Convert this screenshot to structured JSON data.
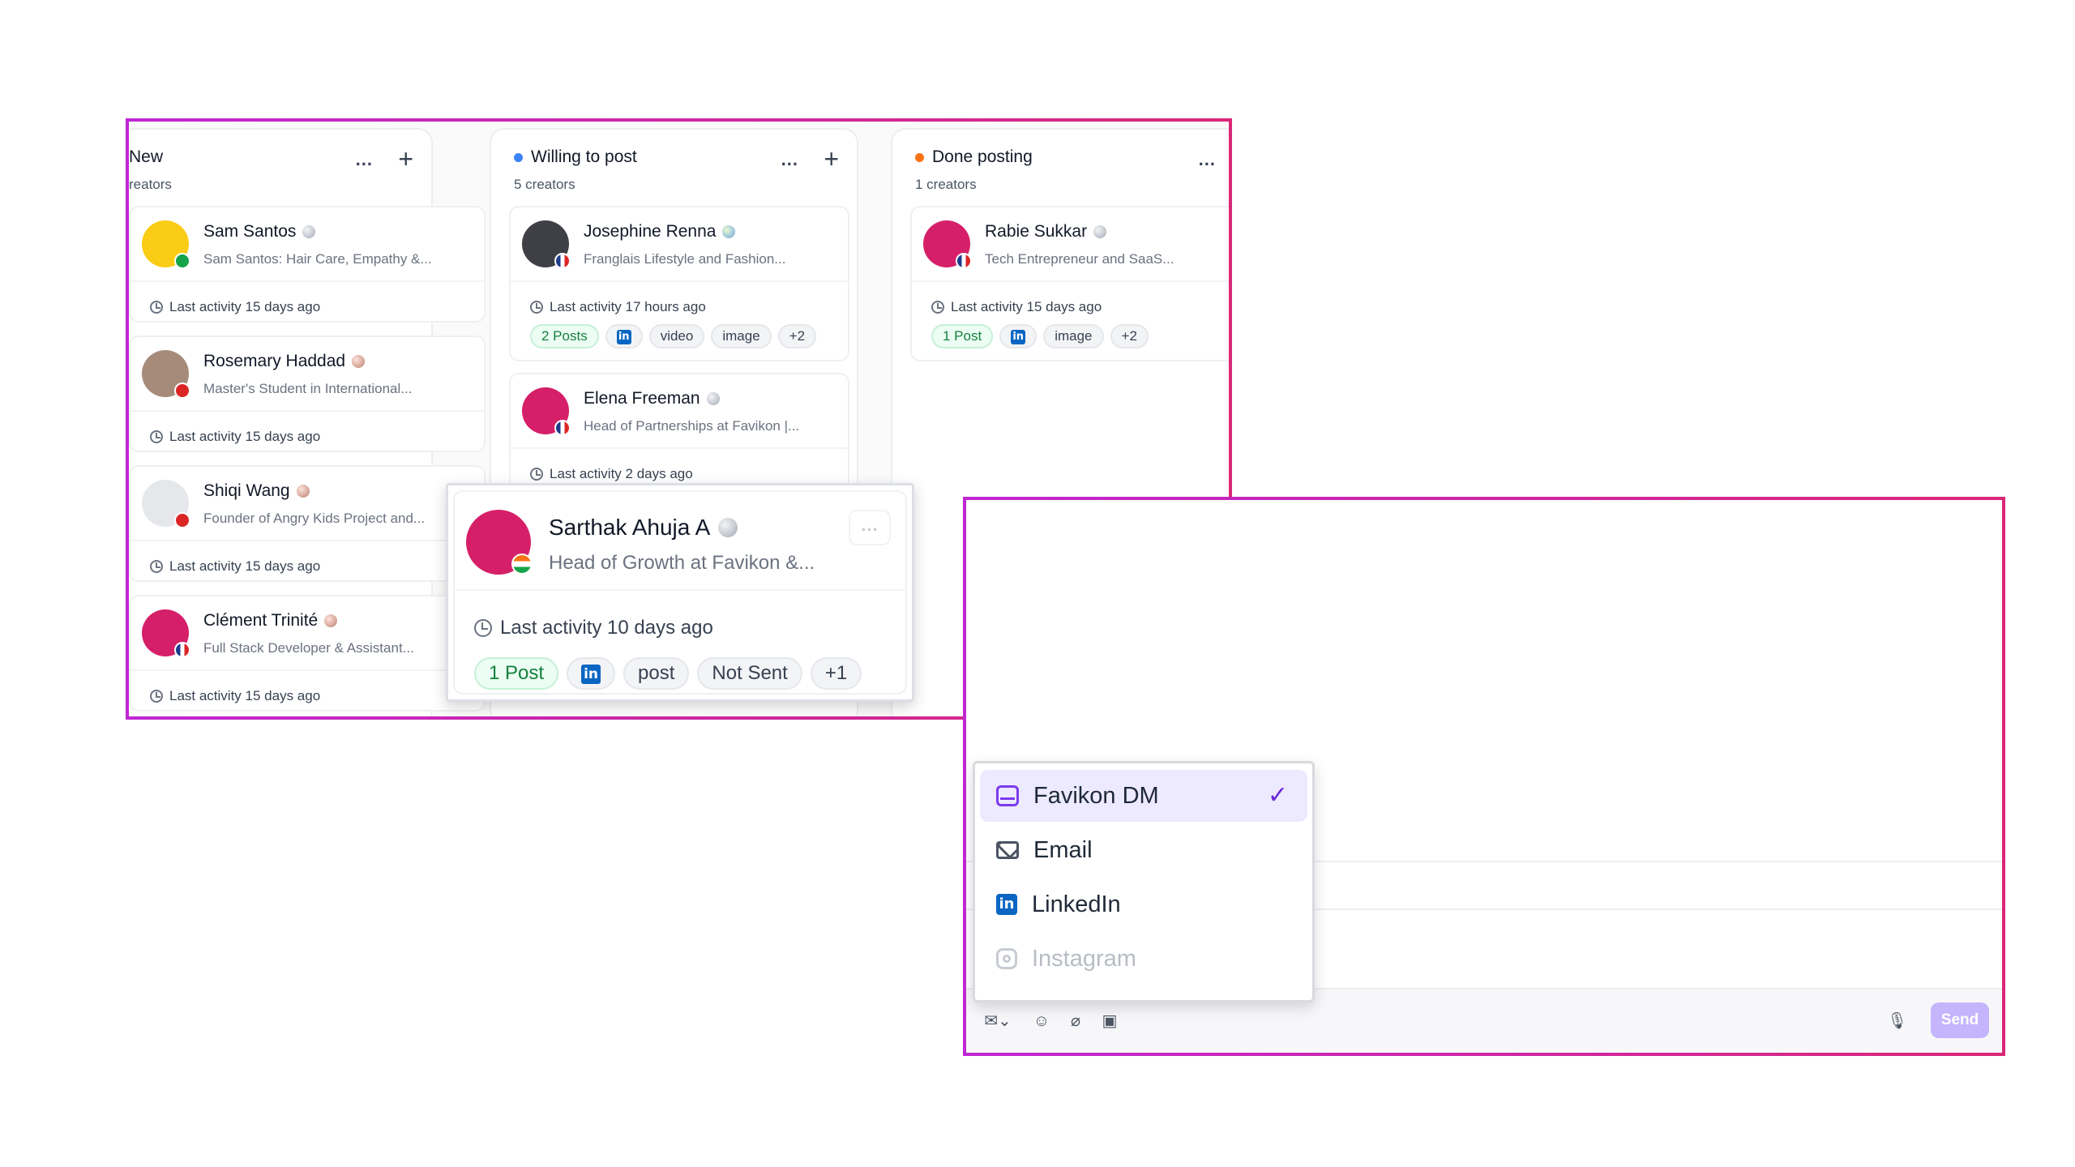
{
  "kanban": {
    "columns": [
      {
        "title": "New",
        "count": "reators",
        "more": "...",
        "add": "+",
        "cards": [
          {
            "name": "Sam Santos",
            "sub": "Sam Santos: Hair Care, Empathy &...",
            "activity": "Last activity 15 days ago"
          },
          {
            "name": "Rosemary Haddad",
            "sub": "Master's Student in International...",
            "activity": "Last activity 15 days ago"
          },
          {
            "name": "Shiqi Wang",
            "sub": "Founder of Angry Kids Project and...",
            "activity": "Last activity 15 days ago"
          },
          {
            "name": "Clément Trinité",
            "sub": "Full Stack Developer & Assistant...",
            "activity": "Last activity 15 days ago"
          }
        ]
      },
      {
        "title": "Willing to post",
        "dot_color": "#3b82f6",
        "count": "5 creators",
        "more": "...",
        "add": "+",
        "cards": [
          {
            "name": "Josephine Renna",
            "sub": "Franglais Lifestyle and Fashion...",
            "activity": "Last activity 17 hours ago",
            "tags": [
              "2 Posts",
              "in",
              "video",
              "image",
              "+2"
            ]
          },
          {
            "name": "Elena Freeman",
            "sub": "Head of Partnerships at Favikon |...",
            "activity": "Last activity 2 days ago"
          }
        ]
      },
      {
        "title": "Done posting",
        "dot_color": "#f97316",
        "count": "1 creators",
        "more": "...",
        "add": "-",
        "cards": [
          {
            "name": "Rabie Sukkar",
            "sub": "Tech Entrepreneur and SaaS...",
            "activity": "Last activity 15 days ago",
            "tags": [
              "1 Post",
              "in",
              "image",
              "+2"
            ]
          }
        ]
      }
    ]
  },
  "popped_card": {
    "name": "Sarthak Ahuja A",
    "sub": "Head of Growth at Favikon &...",
    "activity": "Last activity 10 days ago",
    "more": "...",
    "tags": [
      "1 Post",
      "in",
      "post",
      "Not Sent",
      "+1"
    ]
  },
  "composer": {
    "dropdown": [
      {
        "label": "Favikon DM",
        "icon": "inbox-icon",
        "selected": true
      },
      {
        "label": "Email",
        "icon": "mail-icon"
      },
      {
        "label": "LinkedIn",
        "icon": "linkedin-icon"
      },
      {
        "label": "Instagram",
        "icon": "instagram-icon",
        "disabled": true
      }
    ],
    "check": "✓",
    "send_label": "Send",
    "accent": "#7c3aed"
  }
}
